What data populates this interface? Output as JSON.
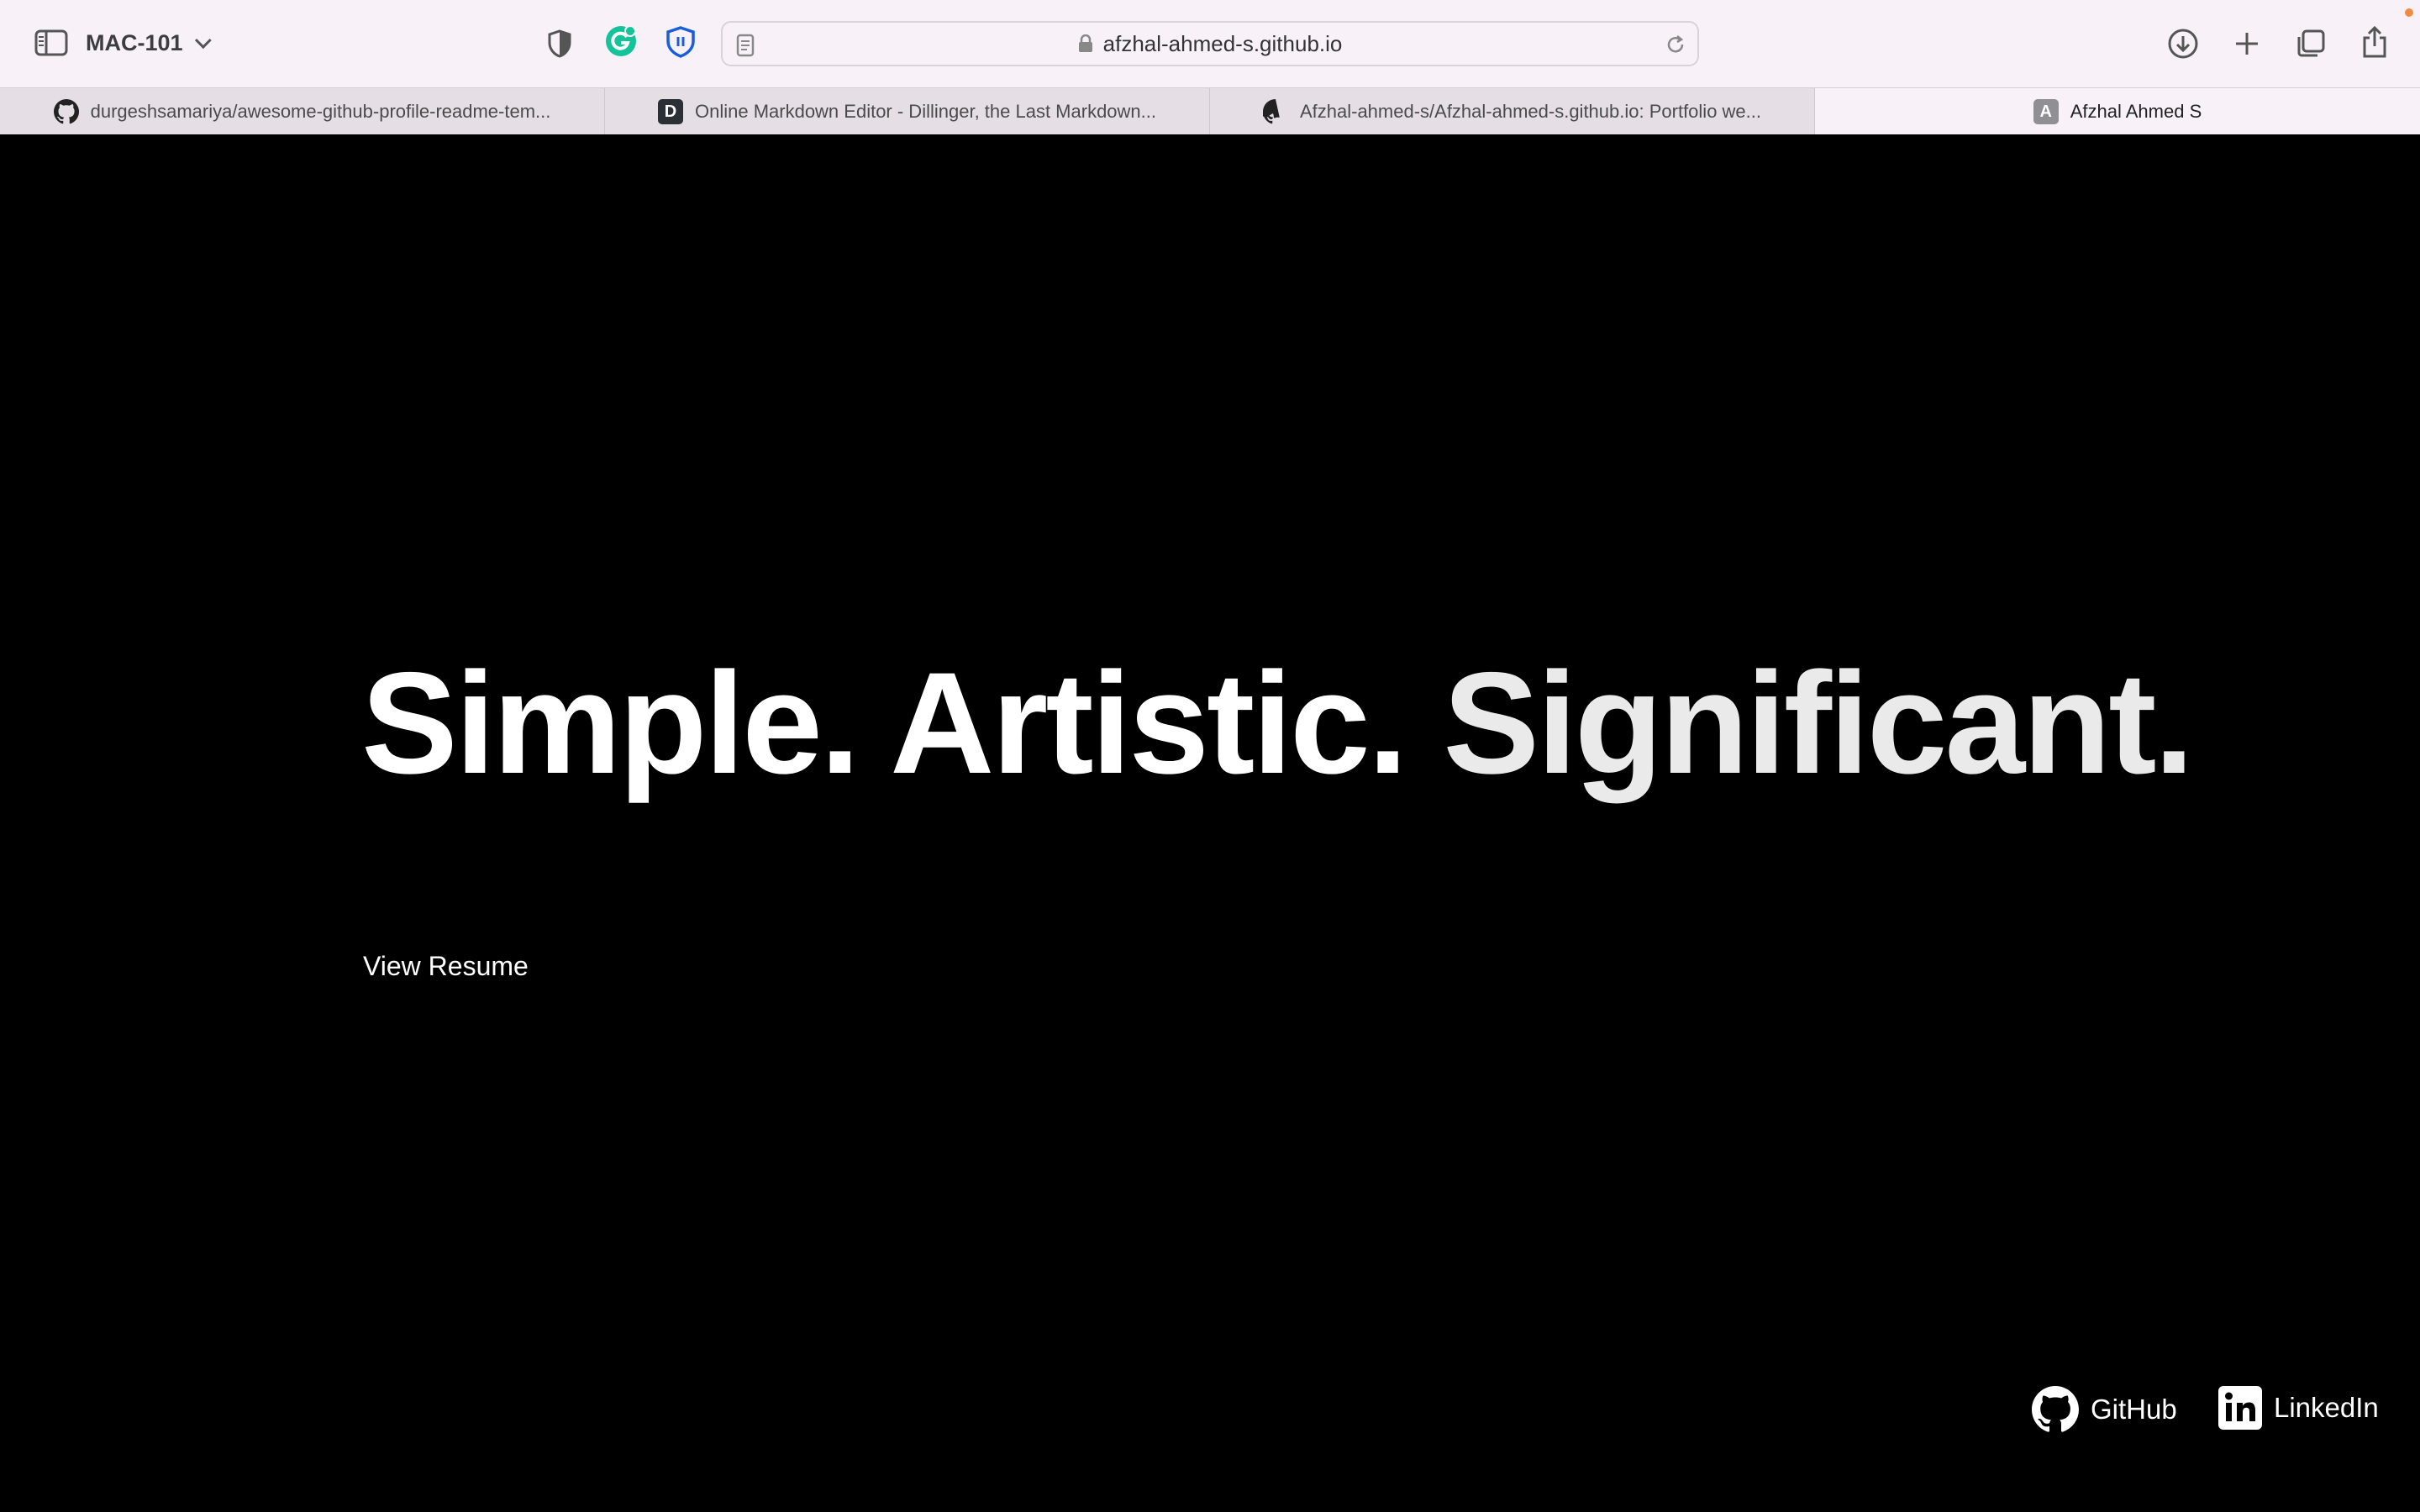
{
  "browser": {
    "profile": "MAC-101",
    "address": "afzhal-ahmed-s.github.io",
    "tabs": [
      {
        "title": "durgeshsamariya/awesome-github-profile-readme-tem...",
        "icon": "github-icon"
      },
      {
        "title": "Online Markdown Editor - Dillinger, the Last Markdown...",
        "icon": "dillinger-icon",
        "icon_text": "D"
      },
      {
        "title": "Afzhal-ahmed-s/Afzhal-ahmed-s.github.io: Portfolio we...",
        "icon": "github-icon"
      },
      {
        "title": "Afzhal Ahmed S",
        "icon": "site-letter-icon",
        "icon_text": "A",
        "active": true
      }
    ]
  },
  "page": {
    "hero": {
      "word1": "Simple.",
      "word2": "Artistic.",
      "word3": "Significant."
    },
    "resume_link": "View Resume",
    "social": {
      "github": "GitHub",
      "linkedin": "LinkedIn"
    }
  },
  "colors": {
    "toolbar_bg": "#f8f2f8",
    "tabstrip_bg": "#e5dfe5",
    "page_bg": "#000000",
    "text_on_dark": "#ffffff",
    "grammarly": "#15c39a",
    "bitwarden": "#175ddc"
  }
}
